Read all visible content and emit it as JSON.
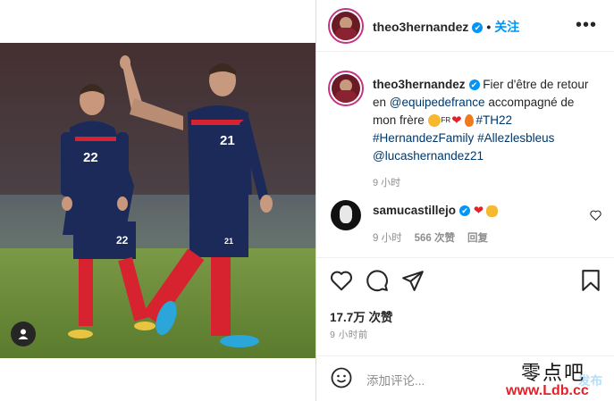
{
  "header": {
    "username": "theo3hernandez",
    "verified_mark": "✔",
    "separator": "•",
    "follow_label": "关注",
    "more_label": "•••"
  },
  "caption": {
    "username": "theo3hernandez",
    "text_1": " Fier d'être de retour en ",
    "mention_1": "@equipedefrance",
    "text_2": " accompagné de mon frère ",
    "flag_text": "FR",
    "hashtag_1": "#TH22",
    "hashtag_2": "#HernandezFamily",
    "hashtag_3": "#Allezlesbleus",
    "mention_2": "@lucashernandez21",
    "time": "9 小时"
  },
  "comment": {
    "username": "samucastillejo",
    "time": "9 小时",
    "likes": "566 次赞",
    "reply": "回复"
  },
  "post": {
    "likes": "17.7万 次赞",
    "time_ago": "9 小时前"
  },
  "composer": {
    "placeholder": "添加评论...",
    "post_label": "发布"
  },
  "watermark": {
    "line1": "零点吧",
    "line2": "www.Ldb.cc"
  },
  "photo": {
    "shirt_numbers": [
      "22",
      "22",
      "21",
      "21"
    ]
  },
  "icons": {
    "tag": "user-tag-icon",
    "like": "heart-icon",
    "comment": "comment-icon",
    "share": "share-icon",
    "save": "bookmark-icon",
    "emoji": "emoji-icon"
  },
  "colors": {
    "accent": "#0095f6",
    "link": "#00376b",
    "muted": "#8e8e8e",
    "france_blue": "#1c2a5a",
    "france_red": "#d6232f"
  }
}
